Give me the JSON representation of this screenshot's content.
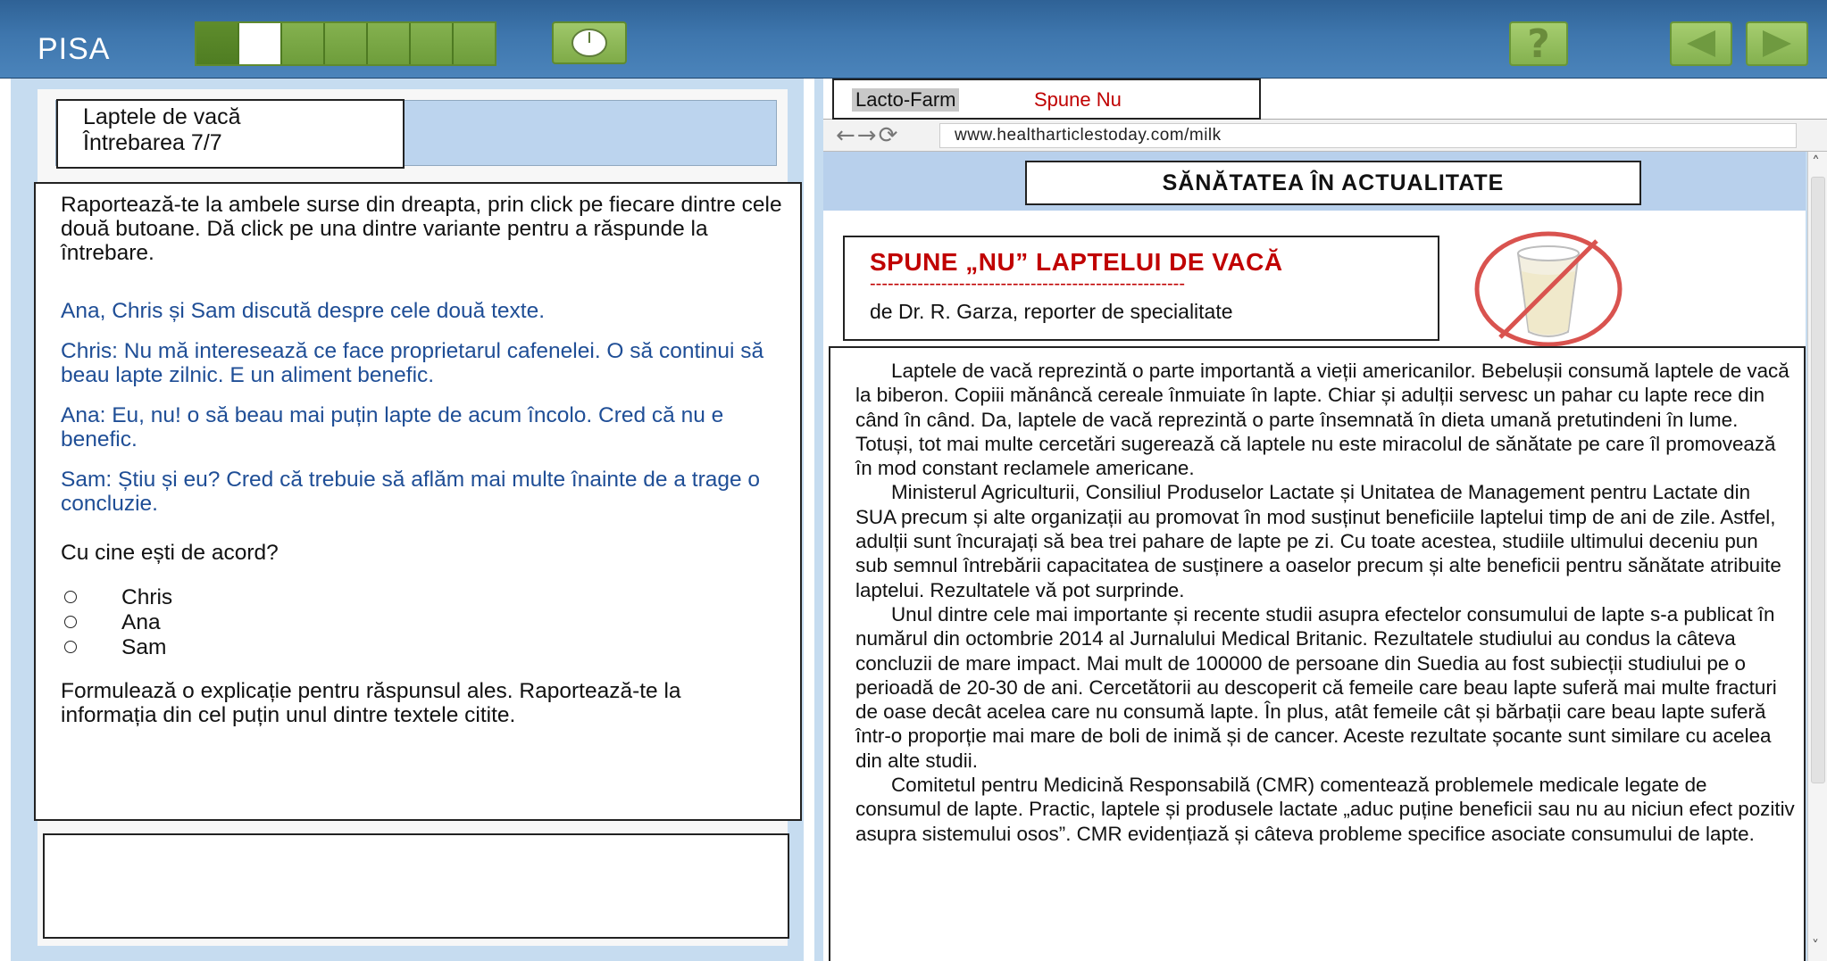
{
  "app": {
    "title": "PISA",
    "progress": {
      "total_steps": 7,
      "current_step": 2
    }
  },
  "icons": {
    "timer": "clock-icon",
    "help": "question-mark-icon",
    "prev": "triangle-left-icon",
    "next": "triangle-right-icon"
  },
  "colors": {
    "header": "#3e76ad",
    "accent_green": "#84b14f",
    "dialog_blue": "#1f4e96",
    "title_red": "#c00000",
    "panel_bg": "#c6dcf0"
  },
  "question": {
    "unit": "Laptele de vacă",
    "number": "Întrebarea 7/7",
    "instruction": "Raportează-te la ambele surse din dreapta, prin click pe fiecare dintre cele două butoane. Dă click pe una dintre variante pentru a răspunde la întrebare.",
    "dialog_intro": "Ana, Chris și Sam discută despre cele două texte.",
    "dialog": [
      "Chris: Nu mă interesează ce face proprietarul cafenelei. O să continui să beau lapte zilnic. E un aliment  benefic.",
      "Ana: Eu, nu! o să beau mai puțin lapte de acum încolo. Cred că nu e benefic.",
      "Sam: Știu și eu? Cred că trebuie să aflăm mai multe înainte de a trage o concluzie."
    ],
    "prompt": "Cu cine ești de acord?",
    "options": [
      "Chris",
      "Ana",
      "Sam"
    ],
    "explain": "Formulează o explicație pentru răspunsul ales. Raportează-te la informația din cel puțin unul dintre textele citite.",
    "answer_value": ""
  },
  "browser": {
    "tabs": [
      "Lacto-Farm",
      "Spune Nu"
    ],
    "active_tab": "Lacto-Farm",
    "nav": {
      "back": "←",
      "forward": "→",
      "reload": "⟳"
    },
    "url": "www.healtharticlestoday.com/milk",
    "site_title": "SĂNĂTATEA ÎN ACTUALITATE",
    "article_title": "SPUNE „NU” LAPTELUI  DE  VACĂ",
    "title_underline": "-----------------------------------------------------",
    "byline": "de Dr. R. Garza, reporter de specialitate",
    "image_icon": "no-milk-glass-icon",
    "paragraphs": [
      "Laptele de vacă reprezintă o parte importantă a vieții americanilor. Bebelușii consumă laptele de vacă la biberon. Copiii mănâncă cereale înmuiate în lapte. Chiar și adulții servesc un pahar cu lapte rece din când în când. Da, laptele de vacă reprezintă o parte însemnată în dieta umană pretutindeni în lume. Totuși, tot mai multe cercetări sugerează că laptele nu este miracolul de sănătate pe care îl promovează în mod constant reclamele americane.",
      "Ministerul Agriculturii, Consiliul Produselor Lactate și Unitatea de Management pentru Lactate din SUA precum și alte organizații au promovat în mod susținut beneficiile laptelui timp de ani de zile. Astfel, adulții sunt încurajați să bea trei pahare de lapte pe zi. Cu toate acestea, studiile ultimului deceniu pun sub semnul întrebării capacitatea de susținere a oaselor precum și alte beneficii pentru sănătate atribuite laptelui. Rezultatele vă pot surprinde.",
      "Unul dintre cele mai importante și recente studii asupra efectelor consumului de lapte s-a publicat în numărul din octombrie 2014 al Jurnalului Medical Britanic. Rezultatele studiului au condus la câteva concluzii de mare impact. Mai mult de 100000 de persoane din Suedia au fost subiecții studiului pe o perioadă de 20-30 de ani. Cercetătorii au descoperit că femeile care beau lapte suferă mai multe fracturi de oase decât acelea care nu consumă lapte. În plus, atât femeile cât și bărbații care beau lapte suferă într-o proporție mai mare de boli de inimă și de cancer. Aceste rezultate șocante sunt similare cu acelea din alte studii.",
      "Comitetul pentru Medicină Responsabilă (CMR) comentează problemele medicale legate de consumul de lapte. Practic, laptele și produsele lactate „aduc puține beneficii sau nu au niciun efect pozitiv asupra sistemului osos”. CMR evidențiază și câteva probleme specifice asociate consumului de lapte."
    ],
    "scroll": {
      "up": "˄",
      "down": "˅"
    }
  }
}
